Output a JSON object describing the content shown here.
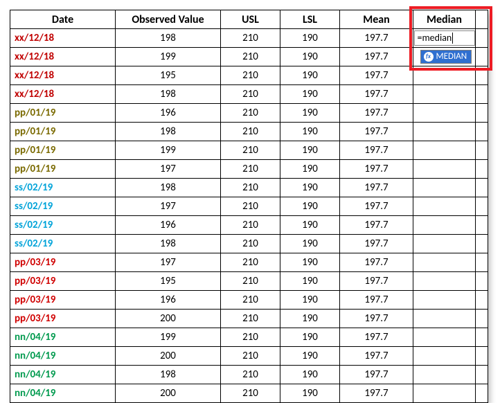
{
  "headers": {
    "date": "Date",
    "observed": "Observed Value",
    "usl": "USL",
    "lsl": "LSL",
    "mean": "Mean",
    "median": "Median"
  },
  "rows": [
    {
      "date": "xx/12/18",
      "color": "c-red",
      "obs": "198",
      "usl": "210",
      "lsl": "190",
      "mean": "197.7"
    },
    {
      "date": "xx/12/18",
      "color": "c-red",
      "obs": "199",
      "usl": "210",
      "lsl": "190",
      "mean": "197.7"
    },
    {
      "date": "xx/12/18",
      "color": "c-red",
      "obs": "195",
      "usl": "210",
      "lsl": "190",
      "mean": "197.7"
    },
    {
      "date": "xx/12/18",
      "color": "c-red",
      "obs": "198",
      "usl": "210",
      "lsl": "190",
      "mean": "197.7"
    },
    {
      "date": "pp/01/19",
      "color": "c-olive",
      "obs": "196",
      "usl": "210",
      "lsl": "190",
      "mean": "197.7"
    },
    {
      "date": "pp/01/19",
      "color": "c-olive",
      "obs": "198",
      "usl": "210",
      "lsl": "190",
      "mean": "197.7"
    },
    {
      "date": "pp/01/19",
      "color": "c-olive",
      "obs": "199",
      "usl": "210",
      "lsl": "190",
      "mean": "197.7"
    },
    {
      "date": "pp/01/19",
      "color": "c-olive",
      "obs": "197",
      "usl": "210",
      "lsl": "190",
      "mean": "197.7"
    },
    {
      "date": "ss/02/19",
      "color": "c-cyan",
      "obs": "198",
      "usl": "210",
      "lsl": "190",
      "mean": "197.7"
    },
    {
      "date": "ss/02/19",
      "color": "c-cyan",
      "obs": "197",
      "usl": "210",
      "lsl": "190",
      "mean": "197.7"
    },
    {
      "date": "ss/02/19",
      "color": "c-cyan",
      "obs": "196",
      "usl": "210",
      "lsl": "190",
      "mean": "197.7"
    },
    {
      "date": "ss/02/19",
      "color": "c-cyan",
      "obs": "198",
      "usl": "210",
      "lsl": "190",
      "mean": "197.7"
    },
    {
      "date": "pp/03/19",
      "color": "c-red2",
      "obs": "197",
      "usl": "210",
      "lsl": "190",
      "mean": "197.7"
    },
    {
      "date": "pp/03/19",
      "color": "c-red2",
      "obs": "195",
      "usl": "210",
      "lsl": "190",
      "mean": "197.7"
    },
    {
      "date": "pp/03/19",
      "color": "c-red2",
      "obs": "196",
      "usl": "210",
      "lsl": "190",
      "mean": "197.7"
    },
    {
      "date": "pp/03/19",
      "color": "c-red2",
      "obs": "200",
      "usl": "210",
      "lsl": "190",
      "mean": "197.7"
    },
    {
      "date": "nn/04/19",
      "color": "c-green",
      "obs": "199",
      "usl": "210",
      "lsl": "190",
      "mean": "197.7"
    },
    {
      "date": "nn/04/19",
      "color": "c-green",
      "obs": "200",
      "usl": "210",
      "lsl": "190",
      "mean": "197.7"
    },
    {
      "date": "nn/04/19",
      "color": "c-green",
      "obs": "198",
      "usl": "210",
      "lsl": "190",
      "mean": "197.7"
    },
    {
      "date": "nn/04/19",
      "color": "c-green",
      "obs": "200",
      "usl": "210",
      "lsl": "190",
      "mean": "197.7"
    }
  ],
  "formula": {
    "text": "=median",
    "suggestion": "MEDIAN",
    "badge": "fx"
  }
}
